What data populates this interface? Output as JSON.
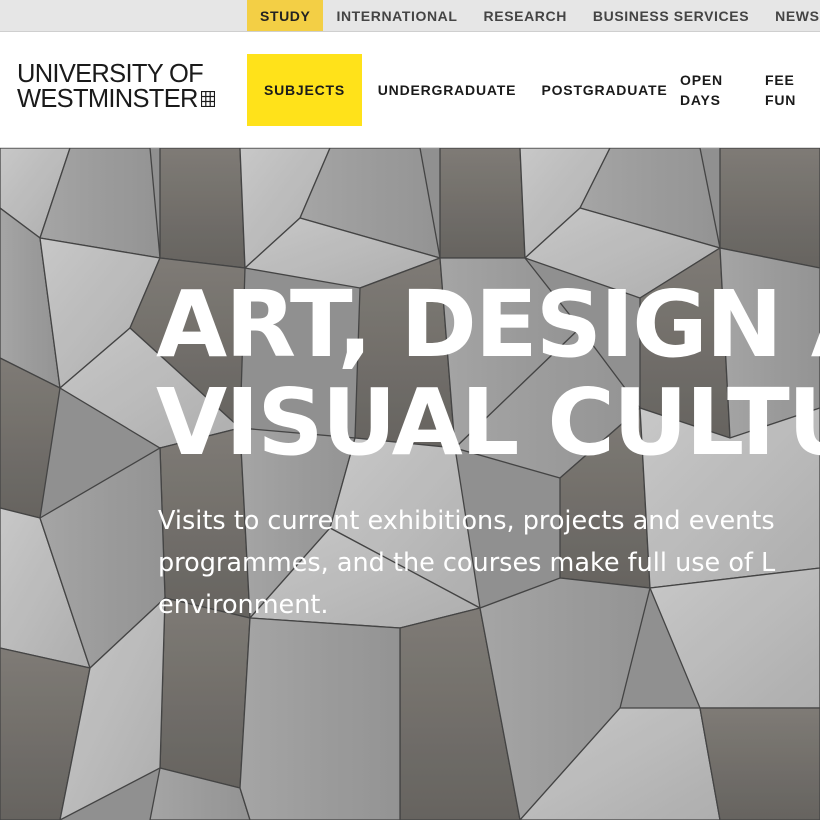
{
  "utility_nav": {
    "items": [
      "STUDY",
      "INTERNATIONAL",
      "RESEARCH",
      "BUSINESS SERVICES",
      "NEWS"
    ]
  },
  "logo": {
    "line1": "UNIVERSITY OF",
    "line2": "WESTMINSTER"
  },
  "main_nav": {
    "subjects": "SUBJECTS",
    "undergraduate": "UNDERGRADUATE",
    "postgraduate": "POSTGRADUATE",
    "open_days_line1": "OPEN",
    "open_days_line2": "DAYS",
    "fees_line1": "FEE",
    "fees_line2": "FUN"
  },
  "hero": {
    "title_line1": "ART, DESIGN A",
    "title_line2": "VISUAL CULTU",
    "text_line1": "Visits to current exhibitions, projects and events",
    "text_line2": "programmes, and the courses make full use of L",
    "text_line3": "environment."
  },
  "colors": {
    "active_utility": "#f3cf45",
    "active_nav": "#ffe21a",
    "text_dark": "#1a1a1a",
    "hero_text": "#ffffff"
  },
  "icons": {
    "logo_mark": "building-grid-icon"
  }
}
